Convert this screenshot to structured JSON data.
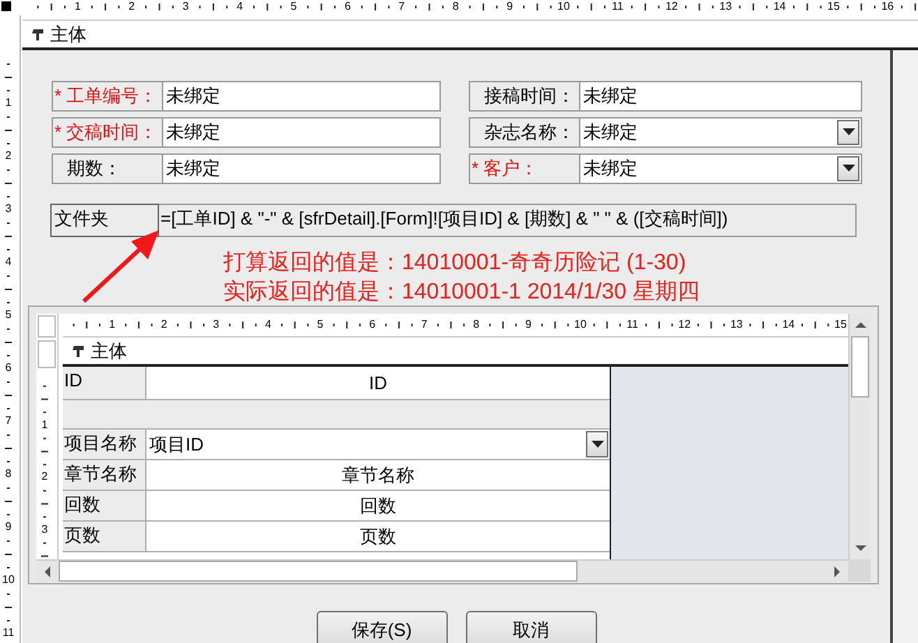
{
  "top_ruler": {
    "labels": [
      "1",
      "2",
      "3",
      "4",
      "5",
      "6",
      "7",
      "8",
      "9",
      "10",
      "11",
      "12",
      "13",
      "14",
      "15",
      "16"
    ]
  },
  "left_ruler": {
    "labels": [
      "1",
      "2",
      "3",
      "4",
      "5",
      "6",
      "7",
      "8",
      "9",
      "10",
      "11"
    ]
  },
  "section": {
    "title": "主体"
  },
  "fields": [
    {
      "label": "* 工单编号：",
      "required": true,
      "value": "未绑定",
      "kind": "text"
    },
    {
      "label": "接稿时间：",
      "required": false,
      "value": "未绑定",
      "kind": "text"
    },
    {
      "label": "* 交稿时间：",
      "required": true,
      "value": "未绑定",
      "kind": "text"
    },
    {
      "label": "杂志名称：",
      "required": false,
      "value": "未绑定",
      "kind": "combo"
    },
    {
      "label": "期数：",
      "required": false,
      "value": "未绑定",
      "kind": "text"
    },
    {
      "label": "* 客户：",
      "required": true,
      "value": "未绑定",
      "kind": "combo"
    }
  ],
  "folder": {
    "label": "文件夹",
    "value": "=[工单ID] & \"-\" & [sfrDetail].[Form]![项目ID] & [期数] & \" \" & ([交稿时间])"
  },
  "annotation": {
    "lines": [
      "打算返回的值是：14010001-奇奇历险记 (1-30)",
      "实际返回的值是：14010001-1 2014/1/30 星期四"
    ]
  },
  "subform": {
    "top_ruler": {
      "labels": [
        "1",
        "2",
        "3",
        "4",
        "5",
        "6",
        "7",
        "8",
        "9",
        "10",
        "11",
        "12",
        "13",
        "14",
        "15"
      ]
    },
    "left_ruler": {
      "labels": [
        "1",
        "2",
        "3"
      ]
    },
    "section_title": "主体",
    "rows": [
      {
        "kind": "text",
        "label": "ID",
        "value": "ID"
      },
      {
        "kind": "blank"
      },
      {
        "kind": "combo",
        "label": "项目名称",
        "value": "项目ID"
      },
      {
        "kind": "text",
        "label": "章节名称",
        "value": "章节名称"
      },
      {
        "kind": "text",
        "label": "回数",
        "value": "回数"
      },
      {
        "kind": "text",
        "label": "页数",
        "value": "页数"
      }
    ]
  },
  "buttons": [
    {
      "label": "保存(S)"
    },
    {
      "label": "取消"
    }
  ]
}
